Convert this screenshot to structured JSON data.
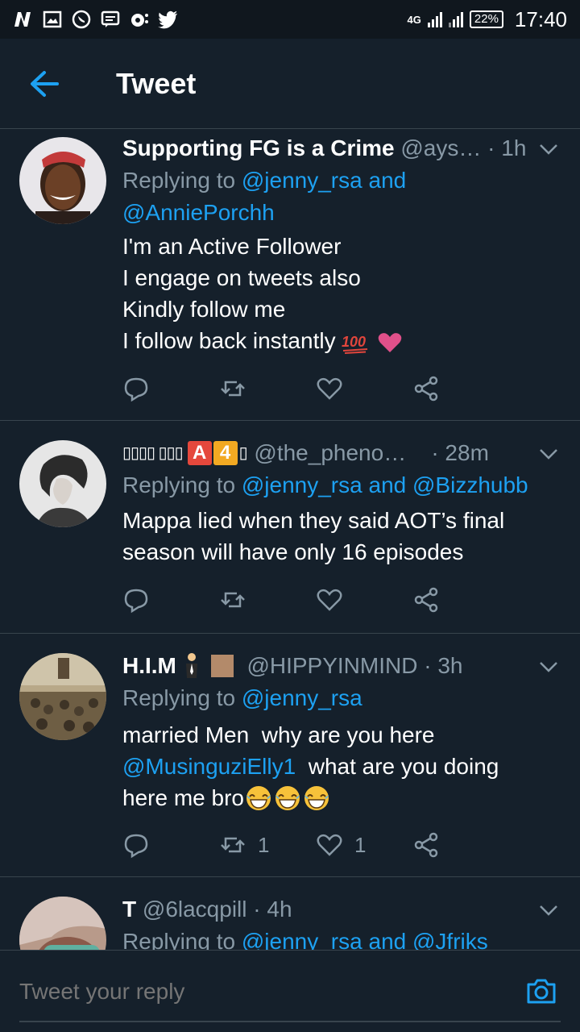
{
  "status_bar": {
    "network": "4G",
    "battery": "22%",
    "time": "17:40"
  },
  "header": {
    "title": "Tweet"
  },
  "tweets": [
    {
      "name": "Supporting FG is a Crime",
      "handle": "@ays…",
      "time": "1h",
      "replying_prefix": "Replying to",
      "replying_1": "@jenny_rsa",
      "replying_and": "and",
      "replying_2": "@AnniePorchh",
      "lines": [
        "I'm an Active Follower",
        "I engage on tweets also",
        "Kindly follow me",
        "I follow back instantly"
      ],
      "emojis": [
        "100-emoji",
        "pink-heart-emoji"
      ]
    },
    {
      "name": "▯▯▯▯ ▯▯▯",
      "name_badges": [
        "A",
        "4"
      ],
      "name_suffix": "▯",
      "handle": "@the_pheno…",
      "time": "28m",
      "replying_prefix": "Replying to",
      "replying_1": "@jenny_rsa",
      "replying_and": "and",
      "replying_2": "@Bizzhubb",
      "lines": [
        "Mappa lied when they said AOT’s final",
        "season will have only 16 episodes"
      ]
    },
    {
      "name": "H.I.M",
      "handle": "@HIPPYINMIND",
      "time": "3h",
      "replying_prefix": "Replying to",
      "replying_1": "@jenny_rsa",
      "line1": "married Men  why are you here",
      "mention": "@MusinguziElly1",
      "line2_rest": "  what are you doing",
      "line3": "here me bro",
      "retweets": "1",
      "likes": "1"
    },
    {
      "name": "T",
      "handle": "@6lacqpill",
      "time": "4h",
      "replying_prefix": "Replying to",
      "replying_1": "@jenny_rsa",
      "replying_and": "and",
      "replying_2": "@Jfriks"
    }
  ],
  "reply_bar": {
    "placeholder": "Tweet your reply"
  },
  "colors": {
    "background": "#15202b",
    "accent": "#1da1f2",
    "secondary_text": "#8899a6",
    "divider": "#38444d"
  }
}
